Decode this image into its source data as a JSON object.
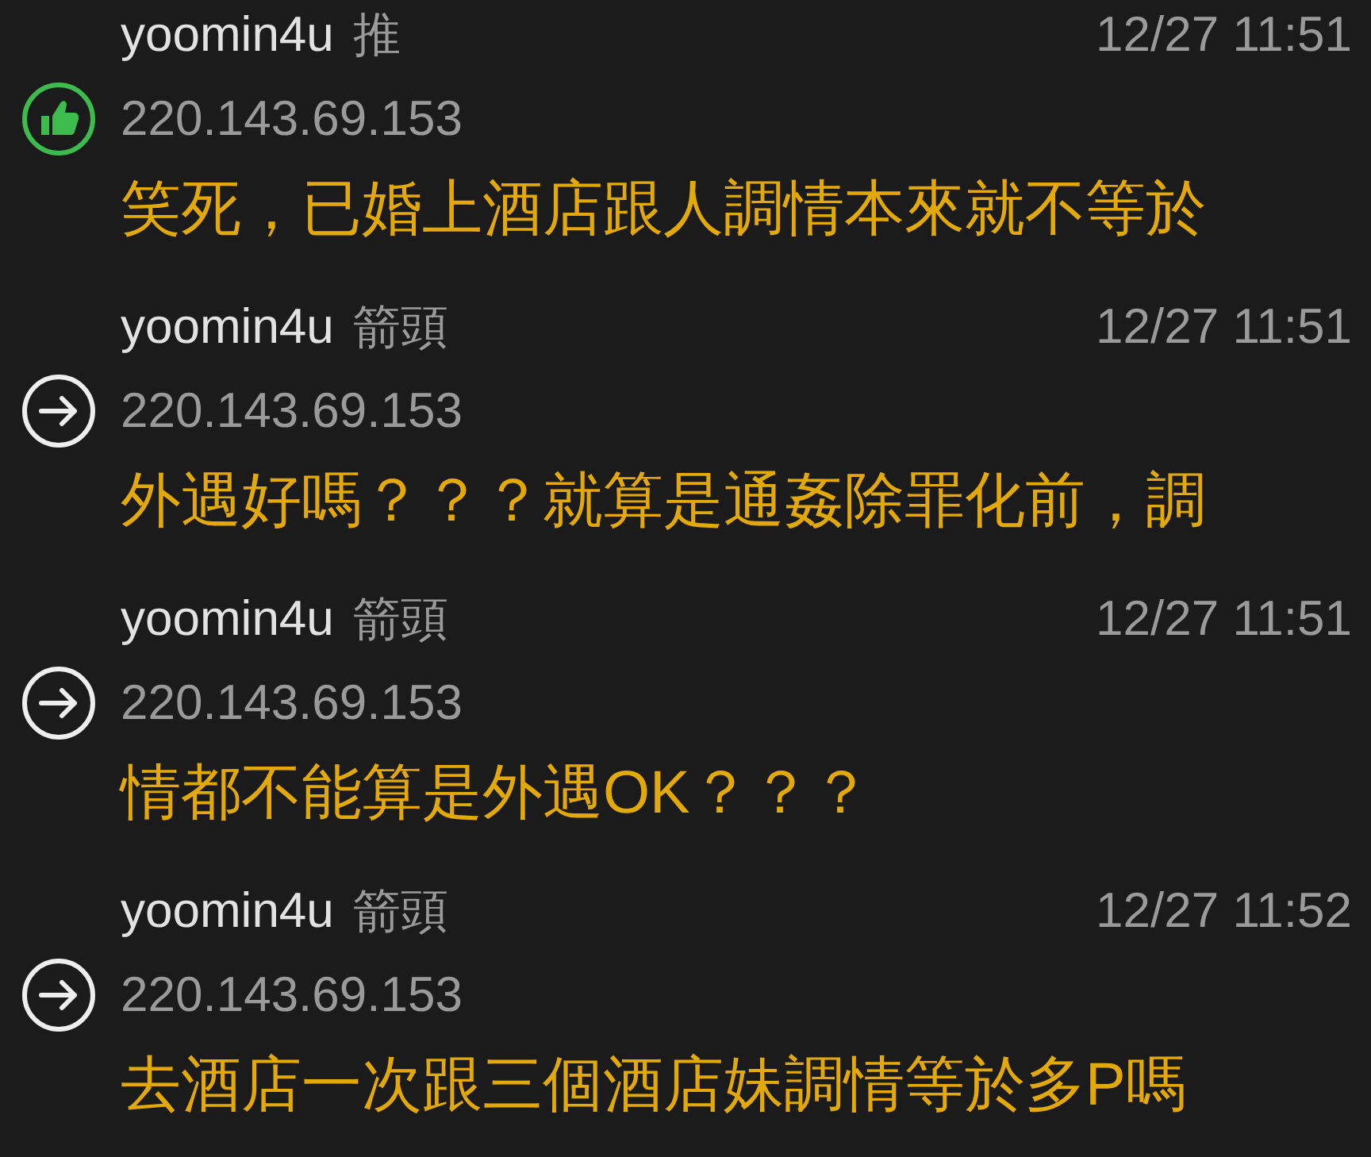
{
  "comments": [
    {
      "kind": "push",
      "user": "yoomin4u",
      "tag": "推",
      "time": "12/27 11:51",
      "ip": "220.143.69.153",
      "text": "笑死，已婚上酒店跟人調情本來就不等於"
    },
    {
      "kind": "arrow",
      "user": "yoomin4u",
      "tag": "箭頭",
      "time": "12/27 11:51",
      "ip": "220.143.69.153",
      "text": "外遇好嗎？？？就算是通姦除罪化前，調"
    },
    {
      "kind": "arrow",
      "user": "yoomin4u",
      "tag": "箭頭",
      "time": "12/27 11:51",
      "ip": "220.143.69.153",
      "text": "情都不能算是外遇OK？？？"
    },
    {
      "kind": "arrow",
      "user": "yoomin4u",
      "tag": "箭頭",
      "time": "12/27 11:52",
      "ip": "220.143.69.153",
      "text": "去酒店一次跟三個酒店妹調情等於多P嗎"
    }
  ]
}
